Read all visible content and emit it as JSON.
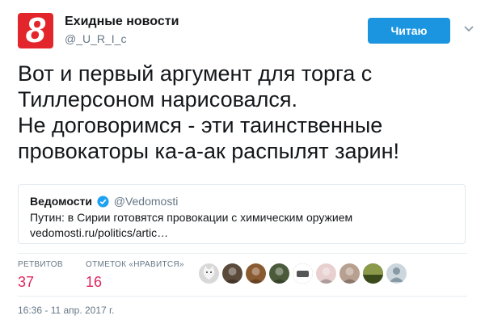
{
  "account": {
    "name": "Ехидные новости",
    "handle": "@_U_R_I_c",
    "avatar_text": "8",
    "avatar_color": "#e3262b"
  },
  "follow_button": {
    "label": "Читаю",
    "color": "#1b95e0"
  },
  "menu_icon": "chevron-down-icon",
  "tweet": {
    "lines": [
      "Вот и первый аргумент для торга с",
      "Тиллерсоном нарисовался.",
      "Не договоримся - эти таинственные",
      "провокаторы ка-а-ак распылят зарин!"
    ]
  },
  "quote": {
    "name": "Ведомости",
    "handle": "@Vedomosti",
    "verified_icon": "verified-badge-icon",
    "text": "Путин: в Сирии готовятся провокации с химическим оружием",
    "link": "vedomosti.ru/politics/artic…"
  },
  "stats": {
    "retweets_label": "РЕТВИТОВ",
    "retweets_count": "37",
    "likes_label": "ОТМЕТОК «НРАВИТСЯ»",
    "likes_count": "16",
    "count_color": "#e0245e"
  },
  "likers": [
    {
      "icon": "cat-avatar",
      "color": "#d8d8d8"
    },
    {
      "icon": "person-avatar",
      "color": "#5a4a3a"
    },
    {
      "icon": "person-avatar",
      "color": "#8a5a30"
    },
    {
      "icon": "person-avatar",
      "color": "#4a5a3a"
    },
    {
      "icon": "object-avatar",
      "color": "#6a6a6a"
    },
    {
      "icon": "person-avatar",
      "color": "#e8d0d0"
    },
    {
      "icon": "person-avatar",
      "color": "#b8a090"
    },
    {
      "icon": "landscape-avatar",
      "color": "#6a7a2a"
    },
    {
      "icon": "default-egg-avatar",
      "color": "#ccd6dd"
    }
  ],
  "timestamp": "16:36 - 11 апр. 2017 г."
}
